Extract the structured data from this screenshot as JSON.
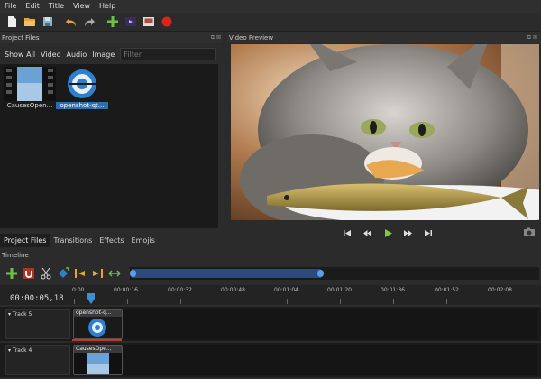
{
  "menu": [
    "File",
    "Edit",
    "Title",
    "View",
    "Help"
  ],
  "toolbar_icons": [
    "new-project-icon",
    "open-project-icon",
    "save-project-icon",
    "undo-icon",
    "redo-icon",
    "import-files-icon",
    "choose-profile-icon",
    "fullscreen-icon",
    "export-video-icon"
  ],
  "project_files": {
    "title": "Project Files",
    "filters": [
      "Show All",
      "Video",
      "Audio",
      "Image"
    ],
    "filter_placeholder": "Filter",
    "clips": [
      {
        "label": "CausesOpen...",
        "selected": false
      },
      {
        "label": "openshot-qt...",
        "selected": true
      }
    ]
  },
  "bottom_tabs": [
    "Project Files",
    "Transitions",
    "Effects",
    "Emojis"
  ],
  "video_preview": {
    "title": "Video Preview"
  },
  "timeline": {
    "title": "Timeline",
    "timecode": "00:00:05,18",
    "ticks": [
      "0:00",
      "00:00:16",
      "00:00:32",
      "00:00:48",
      "00:01:04",
      "00:01:20",
      "00:01:36",
      "00:01:52",
      "00:02:08"
    ],
    "tracks": [
      {
        "name": "Track 5",
        "clip": "openshot-q..."
      },
      {
        "name": "Track 4",
        "clip": "CausesOpe..."
      }
    ]
  },
  "colors": {
    "accent": "#2e6fb0",
    "record": "#d9261c",
    "play": "#8bc34a"
  }
}
